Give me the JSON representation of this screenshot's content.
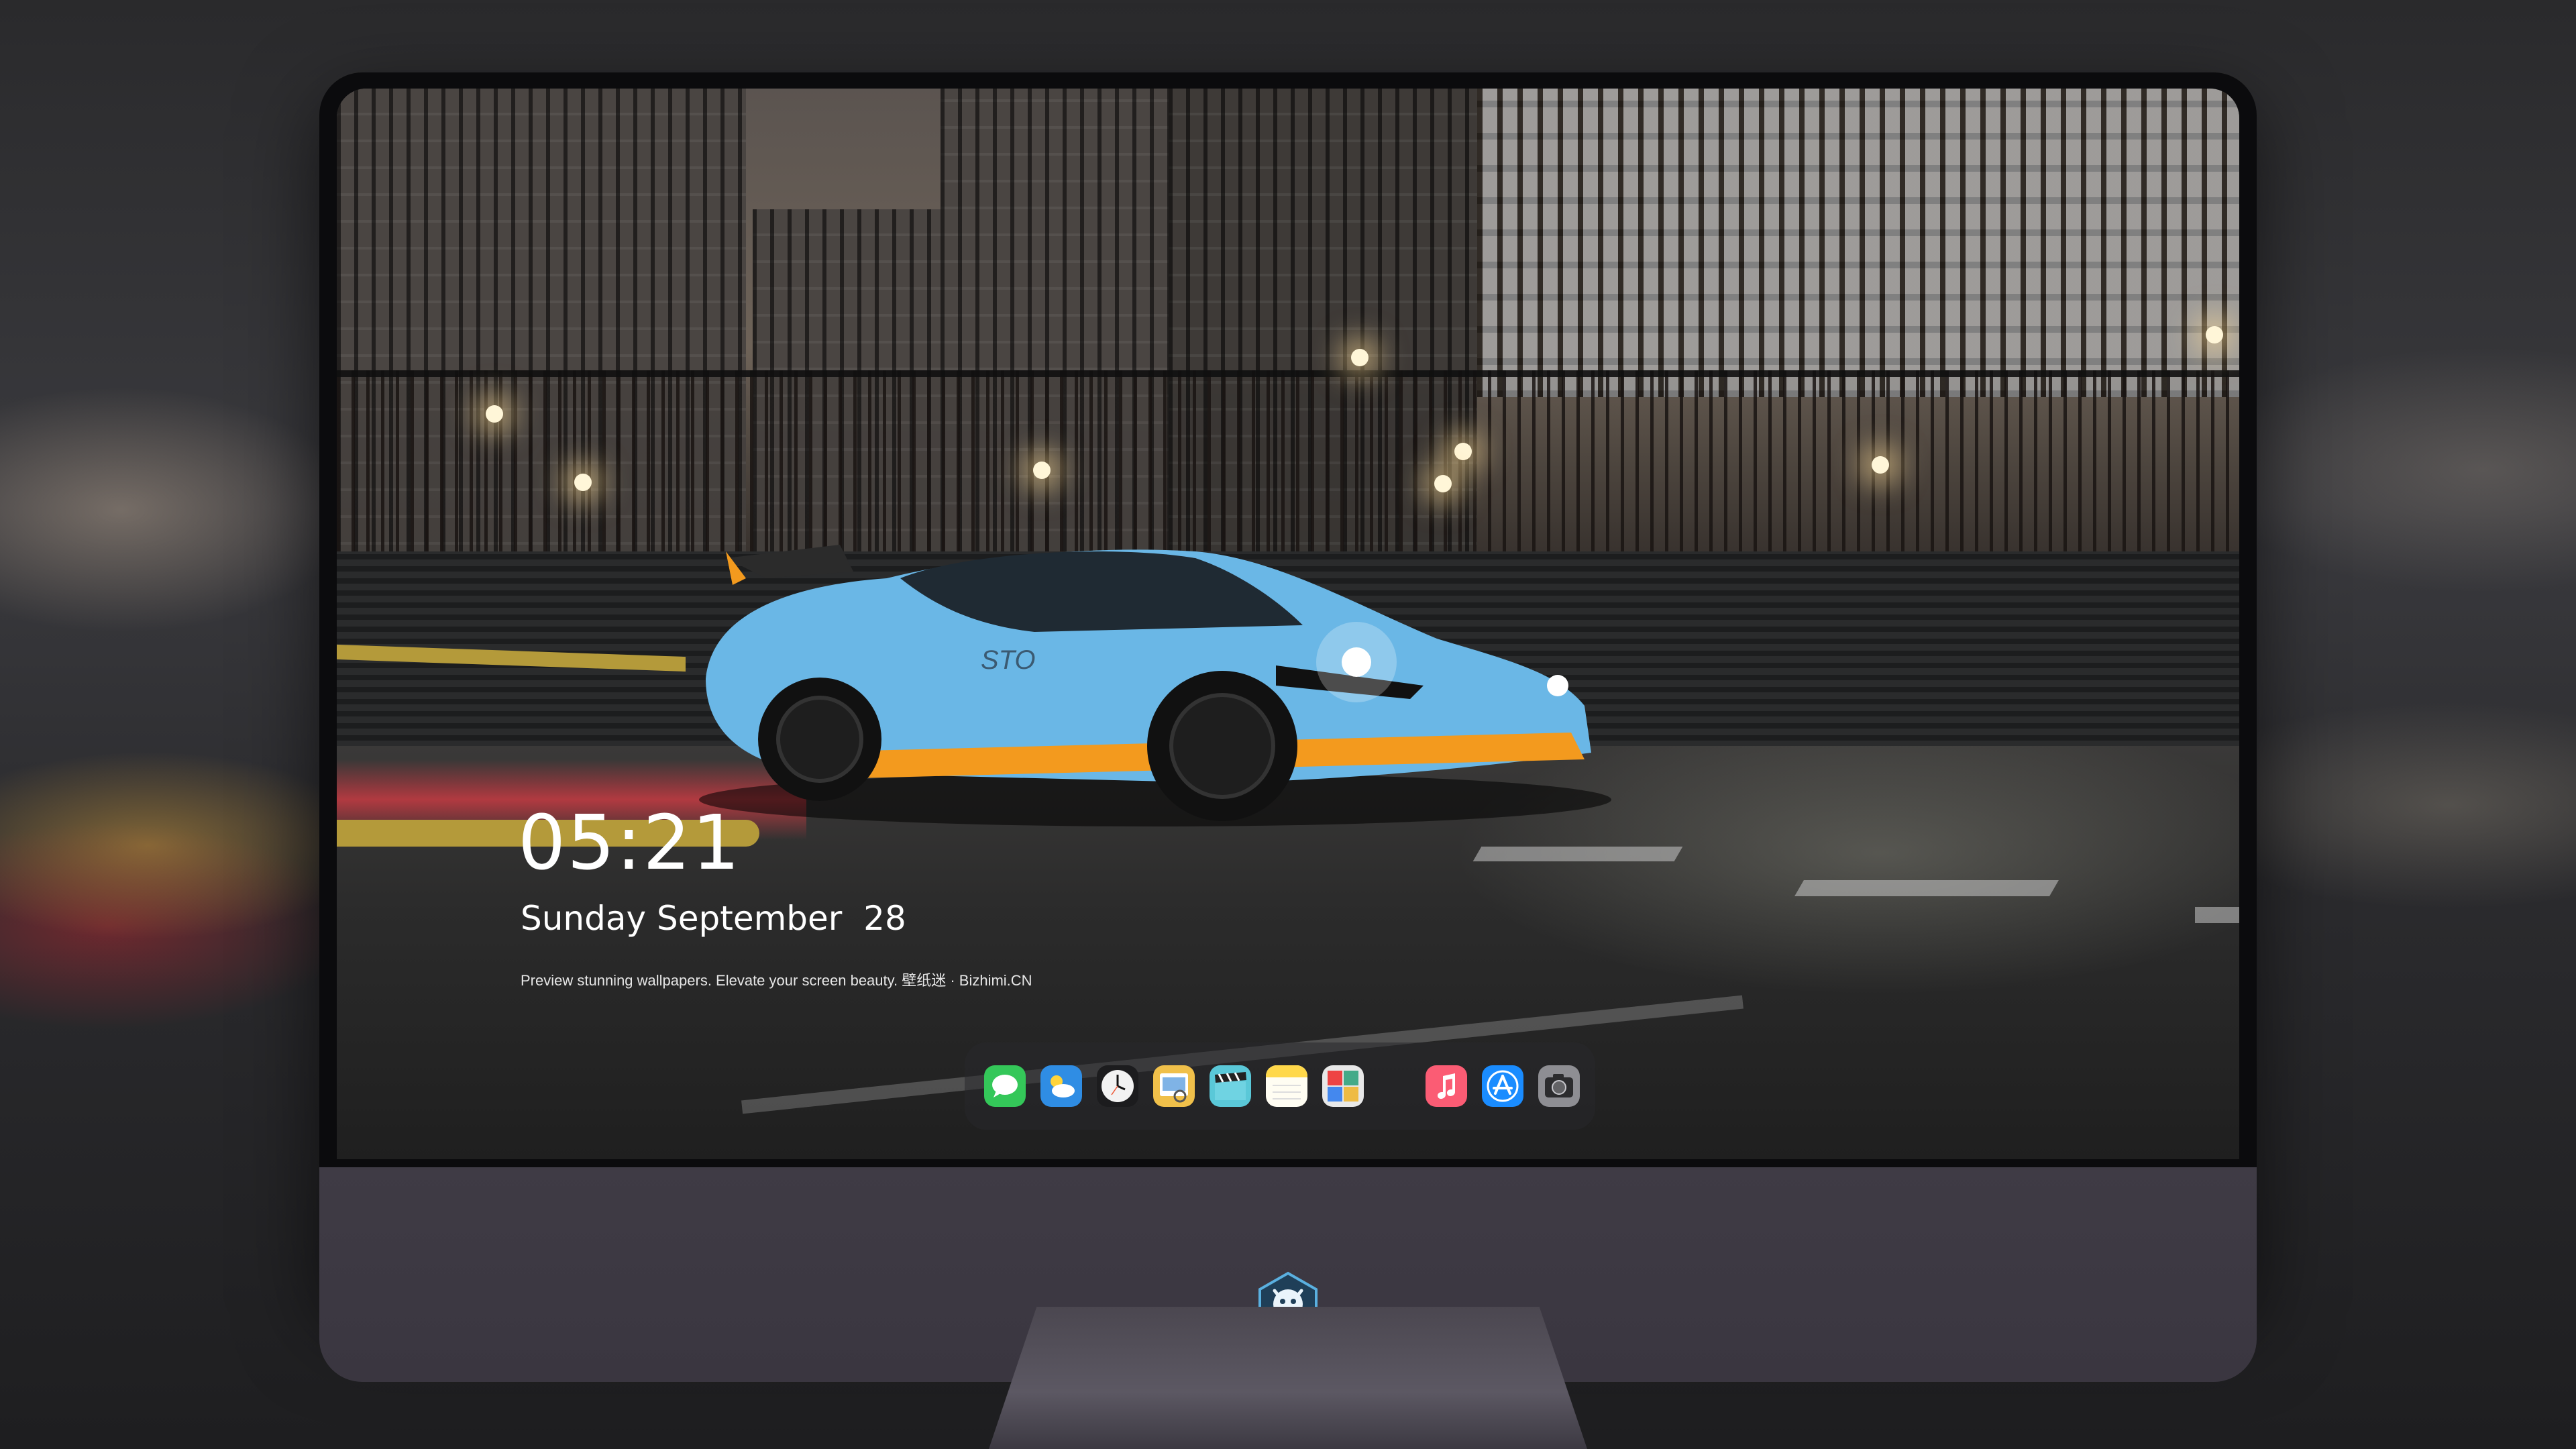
{
  "lockscreen": {
    "time": "05:21",
    "date": "Sunday September  28",
    "tagline": "Preview stunning wallpapers. Elevate your screen beauty. 壁纸迷 · Bizhimi.CN"
  },
  "dock": {
    "apps": [
      {
        "name": "messages-icon",
        "color": "#34c759"
      },
      {
        "name": "weather-icon",
        "color": "#2f8de4"
      },
      {
        "name": "clock-icon",
        "color": "#f2f2f2"
      },
      {
        "name": "preview-icon",
        "color": "#f0c04a"
      },
      {
        "name": "clips-icon",
        "color": "#5ac8d8"
      },
      {
        "name": "notes-icon",
        "color": "#ffd84a"
      },
      {
        "name": "photo-booth-icon",
        "color": "#e8e8e8"
      },
      {
        "name": "music-icon",
        "color": "#fb5c74"
      },
      {
        "name": "app-store-icon",
        "color": "#1a8cff"
      },
      {
        "name": "camera-icon",
        "color": "#8e8e93"
      }
    ]
  },
  "colors": {
    "car_body": "#6ab7e6",
    "car_accent": "#f39a1e",
    "monitor_chin": "#3d3943"
  }
}
